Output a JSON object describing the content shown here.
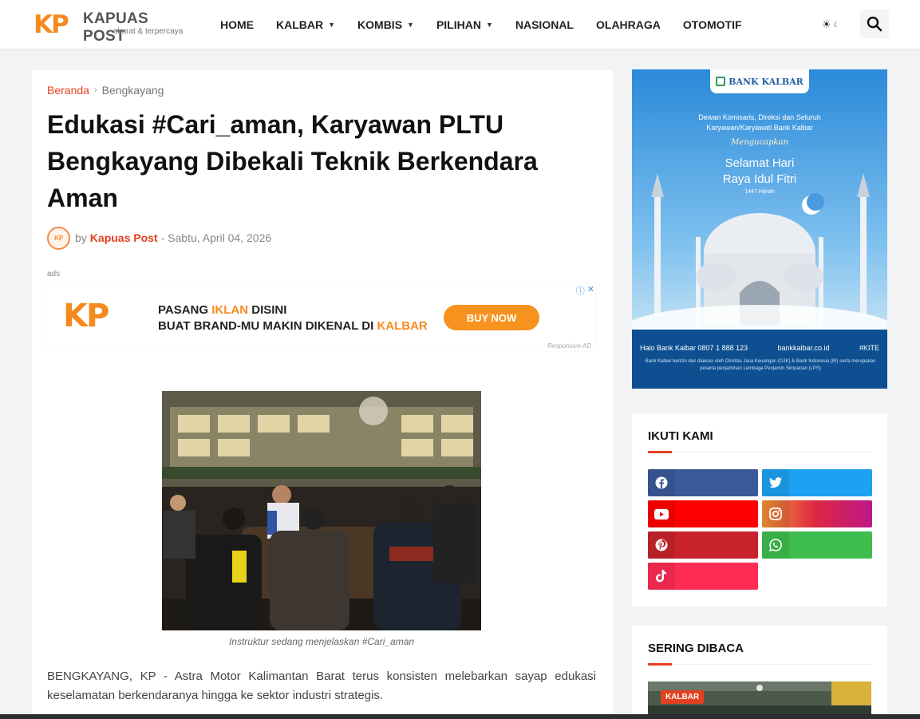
{
  "header": {
    "logo": {
      "mark": "KP",
      "name": "KAPUAS POST",
      "tagline": "akurat & terpercaya"
    },
    "nav": [
      {
        "label": "HOME",
        "dropdown": false
      },
      {
        "label": "KALBAR",
        "dropdown": true
      },
      {
        "label": "KOMBIS",
        "dropdown": true
      },
      {
        "label": "PILIHAN",
        "dropdown": true
      },
      {
        "label": "NASIONAL",
        "dropdown": false
      },
      {
        "label": "OLAHRAGA",
        "dropdown": false
      },
      {
        "label": "OTOMOTIF",
        "dropdown": false
      }
    ],
    "icons": {
      "theme": "sun-moon-icon",
      "search": "search-icon"
    }
  },
  "article": {
    "breadcrumb": {
      "home": "Beranda",
      "sep": "›",
      "current": "Bengkayang"
    },
    "title": "Edukasi #Cari_aman, Karyawan PLTU Bengkayang Dibekali Teknik Berkendara Aman",
    "meta": {
      "by": "by",
      "author": "Kapuas Post",
      "date": "- Sabtu, April 04, 2026",
      "avatar_text": "KP"
    },
    "ads_label": "ads",
    "ad": {
      "logo": "KP",
      "line1_a": "PASANG ",
      "line1_hl": "IKLAN",
      "line1_b": " DISINI",
      "line2_a": "BUAT BRAND-MU MAKIN DIKENAL DI ",
      "line2_hl": "KALBAR",
      "button": "BUY NOW",
      "info": "ⓘ",
      "close": "✕",
      "responsive": "Responsive AD"
    },
    "caption": "Instruktur sedang menjelaskan #Cari_aman",
    "paragraph": "BENGKAYANG, KP - Astra Motor Kalimantan Barat terus konsisten melebarkan sayap edukasi keselamatan berkendaranya hingga ke sektor industri strategis."
  },
  "sidebar": {
    "side_ad": {
      "bank": "BANK KALBAR",
      "line1": "Dewan Komisaris, Direksi dan Seluruh",
      "line1b": "Karyawan/Karyawati Bank Kalbar",
      "line2": "Mengucapkan",
      "line3": "Selamat Hari",
      "line3b": "Raya Idul Fitri",
      "line4": "1447 Hijriah",
      "footer_phone": "Halo Bank Kalbar 0807 1 888 123",
      "footer_web": "bankkalbar.co.id",
      "footer_tag": "#KITE",
      "footer_note": "Bank Kalbar berizin dan diawasi oleh Otoritas Jasa Keuangan (OJK) & Bank Indonesia (BI) serta merupakan peserta penjaminan Lembaga Penjamin Simpanan (LPS)"
    },
    "follow": {
      "title": "IKUTI KAMI",
      "buttons": [
        {
          "name": "facebook",
          "icon": "facebook-icon",
          "color": "#3b5998",
          "glyph": "f"
        },
        {
          "name": "twitter",
          "icon": "twitter-icon",
          "color": "#1da1f2",
          "glyph": "t"
        },
        {
          "name": "youtube",
          "icon": "youtube-icon",
          "color": "#ff0000",
          "glyph": "▶"
        },
        {
          "name": "instagram",
          "icon": "instagram-icon",
          "color": "#d6249f",
          "glyph": "◎"
        },
        {
          "name": "pinterest",
          "icon": "pinterest-icon",
          "color": "#c8232c",
          "glyph": "p"
        },
        {
          "name": "whatsapp",
          "icon": "whatsapp-icon",
          "color": "#3ebd4e",
          "glyph": "✆"
        },
        {
          "name": "tiktok",
          "icon": "tiktok-icon",
          "color": "#fe2c55",
          "glyph": "♪"
        }
      ]
    },
    "popular": {
      "title": "SERING DIBACA",
      "label": "KALBAR"
    }
  }
}
